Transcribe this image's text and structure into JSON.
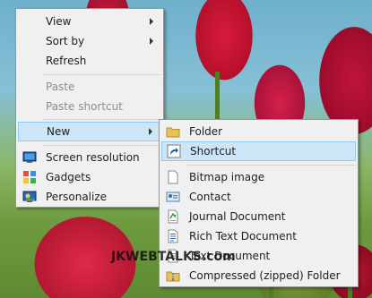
{
  "context_menu": {
    "items": [
      {
        "label": "View",
        "has_submenu": true
      },
      {
        "label": "Sort by",
        "has_submenu": true
      },
      {
        "label": "Refresh"
      },
      {
        "label": "Paste",
        "disabled": true
      },
      {
        "label": "Paste shortcut",
        "disabled": true
      },
      {
        "label": "New",
        "has_submenu": true,
        "highlighted": true
      },
      {
        "label": "Screen resolution",
        "icon": "screen-resolution-icon"
      },
      {
        "label": "Gadgets",
        "icon": "gadgets-icon"
      },
      {
        "label": "Personalize",
        "icon": "personalize-icon"
      }
    ]
  },
  "new_submenu": {
    "items": [
      {
        "label": "Folder",
        "icon": "folder-icon"
      },
      {
        "label": "Shortcut",
        "icon": "shortcut-icon",
        "highlighted": true
      },
      {
        "label": "Bitmap image",
        "icon": "bitmap-icon"
      },
      {
        "label": "Contact",
        "icon": "contact-icon"
      },
      {
        "label": "Journal Document",
        "icon": "journal-icon"
      },
      {
        "label": "Rich Text Document",
        "icon": "rich-text-icon"
      },
      {
        "label": "Text Document",
        "icon": "text-document-icon"
      },
      {
        "label": "Compressed (zipped) Folder",
        "icon": "zip-folder-icon"
      }
    ]
  },
  "watermark": "JKWEBTALKS.com",
  "colors": {
    "highlight": "#cde6f7",
    "highlight_border": "#90c8f6",
    "menu_bg": "#f0f0f0"
  }
}
